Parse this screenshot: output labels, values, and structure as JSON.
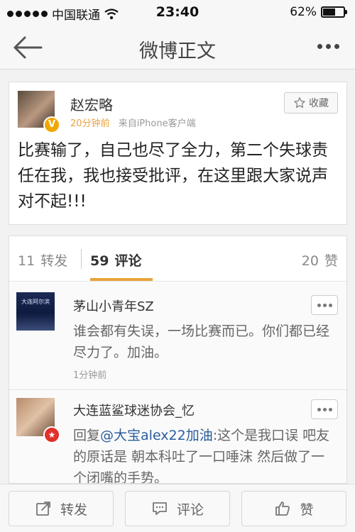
{
  "status_bar": {
    "carrier": "中国联通",
    "time": "23:40",
    "battery_text": "62%",
    "battery_level": 0.62
  },
  "nav": {
    "title": "微博正文",
    "back_icon": "back-arrow-icon",
    "more_icon": "more-dots-icon"
  },
  "post": {
    "author": "赵宏略",
    "verified_badge": "V",
    "time": "20分钟前",
    "source": "来自iPhone客户端",
    "favorite_label": "收藏",
    "text": "比赛输了，自己也尽了全力，第二个失球责任在我，我也接受批评，在这里跟大家说声对不起!!!"
  },
  "tabs": {
    "repost_count": "11",
    "repost_label": "转发",
    "comment_count": "59",
    "comment_label": "评论",
    "like_count": "20",
    "like_label": "赞"
  },
  "comments": [
    {
      "name": "茅山小青年SZ",
      "avatar_caption": "大连阿尔滨",
      "text": "谁会都有失误，一场比赛而已。你们都已经尽力了。加油。",
      "time": "1分钟前"
    },
    {
      "name": "大连蓝鲨球迷协会_忆",
      "reply_prefix": "回复",
      "mention": "@大宝alex22加油",
      "text_rest": ":这个是我口误 吧友的原话是 朝本科吐了一口唾沫 然后做了一个闭嘴的手势。"
    }
  ],
  "toolbar": {
    "repost_label": "转发",
    "comment_label": "评论",
    "like_label": "赞"
  },
  "colors": {
    "accent_orange": "#e8a33c",
    "mention_blue": "#2b5d9c",
    "badge_red": "#e0312a",
    "badge_gold": "#f0a800"
  }
}
